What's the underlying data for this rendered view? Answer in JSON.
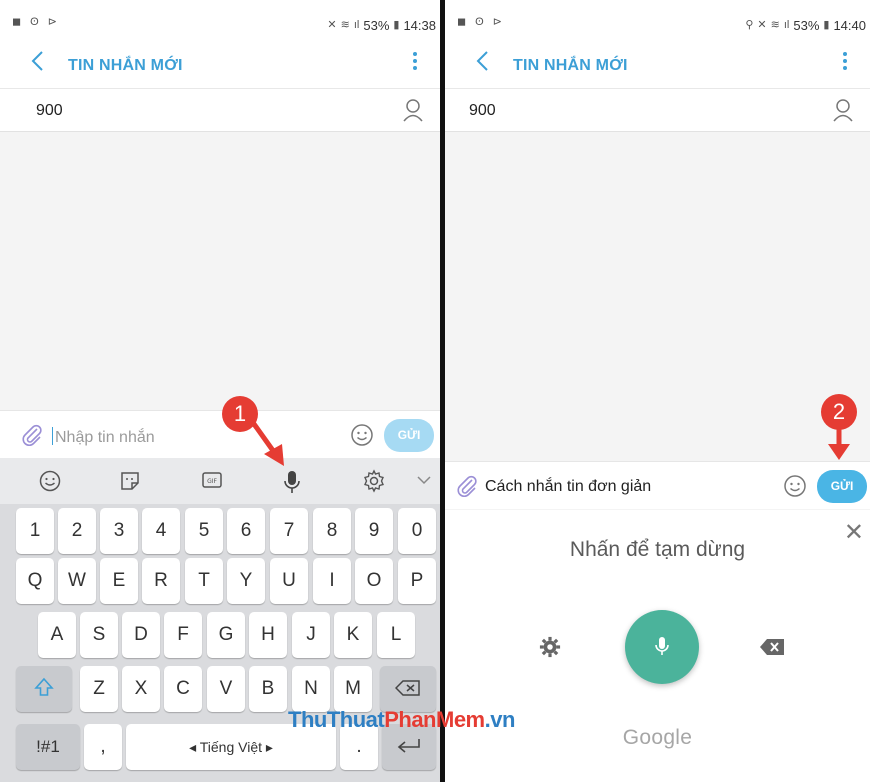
{
  "left": {
    "status": {
      "signal": "53%",
      "time": "14:38"
    },
    "title": "TIN NHẮN MỚI",
    "recipient": "900",
    "message_placeholder": "Nhập tin nhắn",
    "send_label": "GỬI",
    "keyboard": {
      "number_row": [
        "1",
        "2",
        "3",
        "4",
        "5",
        "6",
        "7",
        "8",
        "9",
        "0"
      ],
      "row1": [
        "Q",
        "W",
        "E",
        "R",
        "T",
        "Y",
        "U",
        "I",
        "O",
        "P"
      ],
      "row2": [
        "A",
        "S",
        "D",
        "F",
        "G",
        "H",
        "J",
        "K",
        "L"
      ],
      "row3": [
        "Z",
        "X",
        "C",
        "V",
        "B",
        "N",
        "M"
      ],
      "symbols_label": "!#1",
      "comma": ",",
      "space_label": "◂ Tiếng Việt ▸",
      "period": "."
    },
    "badge": "1"
  },
  "right": {
    "status": {
      "signal": "53%",
      "time": "14:40"
    },
    "title": "TIN NHẮN MỚI",
    "recipient": "900",
    "message_text": "Cách nhắn tin đơn giản",
    "send_label": "GỬI",
    "voice_prompt": "Nhấn để tạm dừng",
    "voice_brand": "Google",
    "badge": "2"
  },
  "watermark": {
    "part1": "ThuThuat",
    "part2": "PhanMem",
    "part3": ".vn"
  },
  "colors": {
    "accent": "#3c9fd6",
    "send_disabled": "#a6daf3",
    "send_active": "#4ab5e5",
    "mic": "#4bb39b",
    "callout": "#e53c33"
  }
}
